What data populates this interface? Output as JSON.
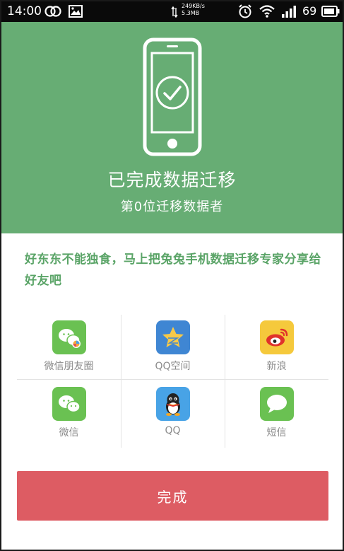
{
  "status_bar": {
    "time": "14:00",
    "speed_rate": "249KB/s",
    "speed_total": "5.3MB",
    "battery_level": "69",
    "icons": [
      "link-icon",
      "image-icon",
      "alarm-icon",
      "wifi-icon",
      "signal-icon",
      "battery-icon"
    ]
  },
  "header": {
    "title": "已完成数据迁移",
    "subtitle": "第0位迁移数据者",
    "background_color": "#67ad74",
    "icon": "phone-check-icon"
  },
  "share": {
    "text": "好东东不能独食，马上把兔兔手机数据迁移专家分享给好友吧"
  },
  "share_targets": [
    {
      "label": "微信朋友圈",
      "icon": "wechat-moments-icon",
      "color": "#6ac152"
    },
    {
      "label": "QQ空间",
      "icon": "qzone-icon",
      "color": "#3f86d3"
    },
    {
      "label": "新浪",
      "icon": "weibo-icon",
      "color": "#f5c93c"
    },
    {
      "label": "微信",
      "icon": "wechat-icon",
      "color": "#6ac152"
    },
    {
      "label": "QQ",
      "icon": "qq-icon",
      "color": "#48a3e6"
    },
    {
      "label": "短信",
      "icon": "sms-icon",
      "color": "#6ac152"
    }
  ],
  "done_button": {
    "label": "完成",
    "color": "#dd5c63"
  }
}
